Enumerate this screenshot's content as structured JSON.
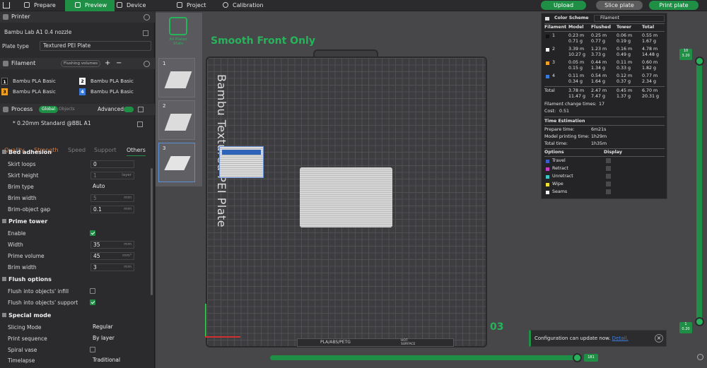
{
  "top": {
    "home_icon": "home-icon",
    "tabs": [
      {
        "label": "Prepare",
        "icon": "cube-icon"
      },
      {
        "label": "Preview",
        "icon": "layers-icon"
      },
      {
        "label": "Device",
        "icon": "monitor-icon"
      },
      {
        "label": "Project",
        "icon": "document-icon"
      },
      {
        "label": "Calibration",
        "icon": "calibrate-icon"
      }
    ],
    "upload": "Upload",
    "slice": "Slice plate",
    "print": "Print plate",
    "accent": "#1f8f46"
  },
  "side": {
    "printer": {
      "title": "Printer",
      "model": "Bambu Lab A1 0.4 nozzle",
      "plate_label": "Plate type",
      "plate_value": "Textured PEI Plate"
    },
    "filament": {
      "title": "Filament",
      "flush_btn": "Flushing volumes",
      "items": [
        {
          "num": "1",
          "name": "Bambu PLA Basic",
          "color": "#111111"
        },
        {
          "num": "2",
          "name": "Bambu PLA Basic",
          "color": "#ffffff"
        },
        {
          "num": "3",
          "name": "Bambu PLA Basic",
          "color": "#f0a020"
        },
        {
          "num": "4",
          "name": "Bambu PLA Basic",
          "color": "#3a7ad8"
        }
      ]
    },
    "process": {
      "title": "Process",
      "global": "Global",
      "objects": "Objects",
      "advanced": "Advanced",
      "preset": "* 0.20mm Standard @BBL A1",
      "tabs": [
        "Quality",
        "Strength",
        "Speed",
        "Support",
        "Others"
      ]
    },
    "bed_adhesion": {
      "title": "Bed adhesion",
      "skirt_loops": {
        "label": "Skirt loops",
        "value": "0"
      },
      "skirt_height": {
        "label": "Skirt height",
        "value": "1",
        "unit": "layer"
      },
      "brim_type": {
        "label": "Brim type",
        "value": "Auto"
      },
      "brim_width": {
        "label": "Brim width",
        "value": "5",
        "unit": "mm"
      },
      "brim_gap": {
        "label": "Brim-object gap",
        "value": "0.1",
        "unit": "mm"
      }
    },
    "prime_tower": {
      "title": "Prime tower",
      "enable": {
        "label": "Enable",
        "checked": true
      },
      "width": {
        "label": "Width",
        "value": "35",
        "unit": "mm"
      },
      "volume": {
        "label": "Prime volume",
        "value": "45",
        "unit": "mm³"
      },
      "brim": {
        "label": "Brim width",
        "value": "3",
        "unit": "mm"
      }
    },
    "flush": {
      "title": "Flush options",
      "infill": {
        "label": "Flush into objects' infill",
        "checked": false
      },
      "support": {
        "label": "Flush into objects' support",
        "checked": true
      }
    },
    "special": {
      "title": "Special mode",
      "slicing": {
        "label": "Slicing Mode",
        "value": "Regular"
      },
      "sequence": {
        "label": "Print sequence",
        "value": "By layer"
      },
      "spiral": {
        "label": "Spiral vase",
        "checked": false
      },
      "timelapse": {
        "label": "Timelapse",
        "value": "Traditional"
      }
    }
  },
  "canvas": {
    "all_plates": "All Plates Stats",
    "thumbs": [
      "1",
      "2",
      "3"
    ],
    "plate_title": "Smooth Front Only",
    "bed_label": "Bambu Textured PEI Plate",
    "plate_number": "03",
    "strip_text": "PLA/ABS/PETG",
    "strip_right": "HOT SURFACE"
  },
  "stats": {
    "color_scheme_label": "Color Scheme",
    "color_scheme_value": "Filament",
    "headers": [
      "Filament",
      "Model",
      "Flushed",
      "Tower",
      "Total"
    ],
    "rows": [
      {
        "id": "1",
        "color": "#111111",
        "model": [
          "0.23 m",
          "0.71 g"
        ],
        "flushed": [
          "0.25 m",
          "0.77 g"
        ],
        "tower": [
          "0.06 m",
          "0.19 g"
        ],
        "total": [
          "0.55 m",
          "1.67 g"
        ]
      },
      {
        "id": "2",
        "color": "#ffffff",
        "model": [
          "3.39 m",
          "10.27 g"
        ],
        "flushed": [
          "1.23 m",
          "3.73 g"
        ],
        "tower": [
          "0.16 m",
          "0.49 g"
        ],
        "total": [
          "4.78 m",
          "14.48 g"
        ]
      },
      {
        "id": "3",
        "color": "#f0a020",
        "model": [
          "0.05 m",
          "0.15 g"
        ],
        "flushed": [
          "0.44 m",
          "1.34 g"
        ],
        "tower": [
          "0.11 m",
          "0.33 g"
        ],
        "total": [
          "0.60 m",
          "1.82 g"
        ]
      },
      {
        "id": "4",
        "color": "#3a7ad8",
        "model": [
          "0.11 m",
          "0.34 g"
        ],
        "flushed": [
          "0.54 m",
          "1.64 g"
        ],
        "tower": [
          "0.12 m",
          "0.37 g"
        ],
        "total": [
          "0.77 m",
          "2.34 g"
        ]
      }
    ],
    "total": {
      "label": "Total",
      "model": [
        "3.78 m",
        "11.47 g"
      ],
      "flushed": [
        "2.47 m",
        "7.47 g"
      ],
      "tower": [
        "0.45 m",
        "1.37 g"
      ],
      "total": [
        "6.70 m",
        "20.31 g"
      ]
    },
    "change_times": "Filament change times:",
    "change_value": "17",
    "cost_label": "Cost:",
    "cost_value": "0.51",
    "time_title": "Time Estimation",
    "prepare_label": "Prepare time:",
    "prepare_value": "6m21s",
    "model_time_label": "Model printing time:",
    "model_time_value": "1h29m",
    "total_time_label": "Total time:",
    "total_time_value": "1h35m",
    "options_label": "Options",
    "display_label": "Display",
    "options": [
      {
        "name": "Travel",
        "color": "#3a5fc8"
      },
      {
        "name": "Retract",
        "color": "#c83ac8"
      },
      {
        "name": "Unretract",
        "color": "#3ac8c8"
      },
      {
        "name": "Wipe",
        "color": "#f0e030"
      },
      {
        "name": "Seams",
        "color": "#f0f0f0"
      }
    ]
  },
  "sliders": {
    "v_top": "10\n3.20",
    "v_bottom": "1\n0.20",
    "h_value": "181"
  },
  "notice": {
    "text": "Configuration can update now.",
    "link": "Detail."
  }
}
